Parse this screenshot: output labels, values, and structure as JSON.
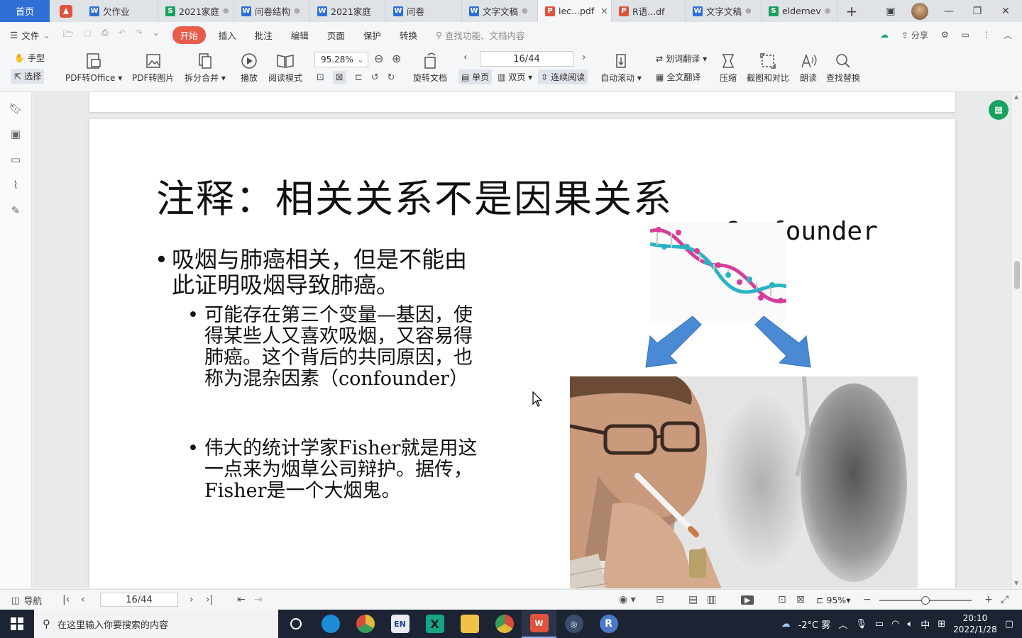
{
  "tabs": {
    "home": "首页",
    "items": [
      {
        "label": "欠作业",
        "icon": "W",
        "color": "#2f6fd6"
      },
      {
        "label": "2021家庭",
        "icon": "S",
        "color": "#19a15f"
      },
      {
        "label": "问卷结构",
        "icon": "W",
        "color": "#2f6fd6"
      },
      {
        "label": "2021家庭",
        "icon": "W",
        "color": "#2f6fd6"
      },
      {
        "label": "问卷",
        "icon": "W",
        "color": "#2f6fd6"
      },
      {
        "label": "文字文稿",
        "icon": "W",
        "color": "#2f6fd6"
      },
      {
        "label": "lec...pdf",
        "icon": "P",
        "color": "#e0533e"
      },
      {
        "label": "R语...df",
        "icon": "P",
        "color": "#e0533e"
      },
      {
        "label": "文字文稿",
        "icon": "W",
        "color": "#2f6fd6"
      },
      {
        "label": "eldernev",
        "icon": "S",
        "color": "#19a15f"
      }
    ]
  },
  "menubar": {
    "file": "文件",
    "start": "开始",
    "items": [
      "插入",
      "批注",
      "编辑",
      "页面",
      "保护",
      "转换"
    ],
    "search_placeholder": "查找功能、文档内容",
    "share": "分享"
  },
  "toolbar": {
    "hand": "手型",
    "select": "选择",
    "pdf_to_office": "PDF转Office",
    "pdf_to_image": "PDF转图片",
    "split_merge": "拆分合并",
    "play": "播放",
    "read_mode": "阅读模式",
    "zoom": "95.28%",
    "rotate": "旋转文档",
    "page": "16/44",
    "single": "单页",
    "double": "双页",
    "continuous": "连续阅读",
    "autoscroll": "自动滚动",
    "word_translate": "划词翻译",
    "full_translate": "全文翻译",
    "compress": "压缩",
    "screenshot_compare": "截图和对比",
    "read_aloud": "朗读",
    "find_replace": "查找替换"
  },
  "slide": {
    "title": "注释：相关关系不是因果关系",
    "bullet1": "吸烟与肺癌相关，但是不能由此证明吸烟导致肺癌。",
    "sub1": "可能存在第三个变量—基因，使得某些人又喜欢吸烟，又容易得肺癌。这个背后的共同原因，也称为混杂因素（confounder）",
    "sub2": "伟大的统计学家Fisher就是用这一点来为烟草公司辩护。据传，Fisher是一个大烟鬼。",
    "confounder": "Confounder"
  },
  "statusbar": {
    "nav": "导航",
    "page": "16/44",
    "zoom": "95%",
    "zoom_level": 0.5
  },
  "taskbar": {
    "search_placeholder": "在这里输入你要搜索的内容",
    "weather": "-2°C 雾",
    "ime": "中",
    "time": "20:10",
    "date": "2022/1/28"
  }
}
